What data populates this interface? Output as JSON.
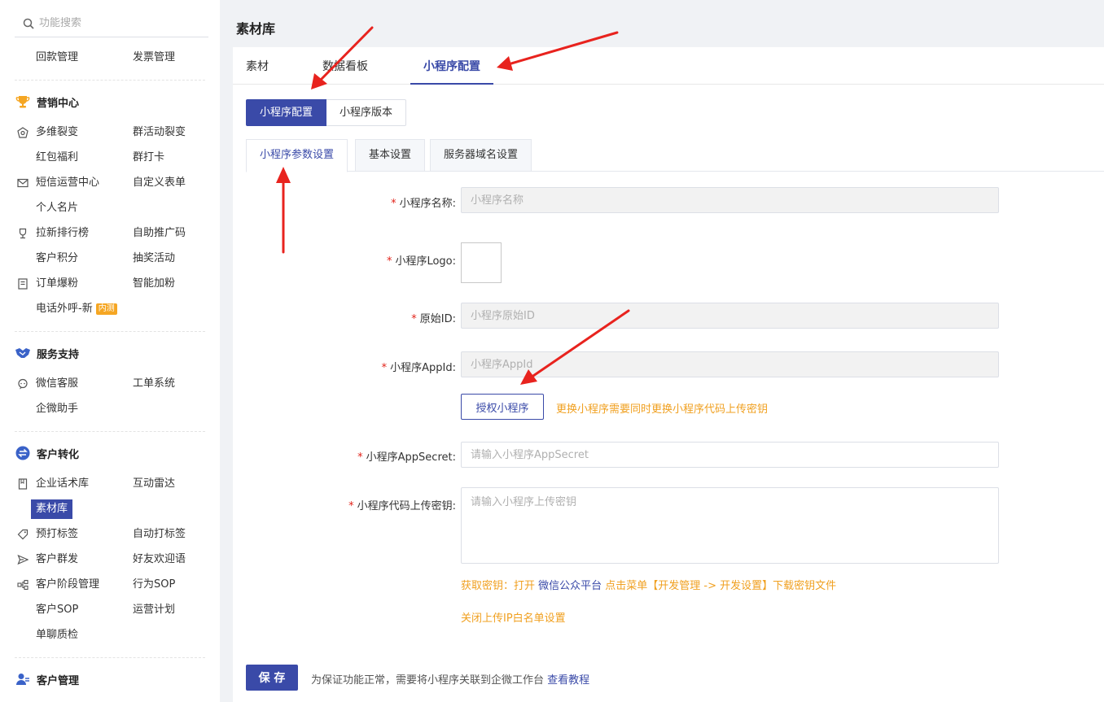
{
  "colors": {
    "accent": "#3a4aa8",
    "hint": "#f0a020",
    "required": "#e2231a",
    "arrow": "#e8231e"
  },
  "sidebar": {
    "search_placeholder": "功能搜索",
    "top": {
      "left": "回款管理",
      "right": "发票管理"
    },
    "marketing": {
      "title": "营销中心",
      "icon": "trophy-icon",
      "rows": [
        {
          "left": "多维裂变",
          "right": "群活动裂变",
          "icon": "network-icon"
        },
        {
          "left": "红包福利",
          "right": "群打卡"
        },
        {
          "left": "短信运营中心",
          "right": "自定义表单",
          "icon": "mail-icon"
        },
        {
          "left": "个人名片",
          "right": ""
        },
        {
          "left": "拉新排行榜",
          "right": "自助推广码",
          "icon": "cup-icon"
        },
        {
          "left": "客户积分",
          "right": "抽奖活动"
        },
        {
          "left": "订单爆粉",
          "right": "智能加粉",
          "icon": "order-icon"
        },
        {
          "left": "电话外呼-新",
          "right": "",
          "badge": "内测"
        }
      ]
    },
    "service": {
      "title": "服务支持",
      "icon": "handshake-icon",
      "rows": [
        {
          "left": "微信客服",
          "right": "工单系统",
          "icon": "chat-icon"
        },
        {
          "left": "企微助手",
          "right": ""
        }
      ]
    },
    "conversion": {
      "title": "客户转化",
      "icon": "swap-icon",
      "rows": [
        {
          "left": "企业话术库",
          "right": "互动雷达",
          "icon": "book-icon"
        },
        {
          "left": "素材库",
          "right": "",
          "active": true
        },
        {
          "left": "预打标签",
          "right": "自动打标签",
          "icon": "tag-icon"
        },
        {
          "left": "客户群发",
          "right": "好友欢迎语",
          "icon": "send-icon"
        },
        {
          "left": "客户阶段管理",
          "right": "行为SOP",
          "icon": "flow-icon"
        },
        {
          "left": "客户SOP",
          "right": "运营计划"
        },
        {
          "left": "单聊质检",
          "right": ""
        }
      ]
    },
    "customer": {
      "title": "客户管理",
      "icon": "user-manage-icon"
    }
  },
  "main": {
    "page_title": "素材库",
    "top_tabs": [
      "素材",
      "数据看板",
      "小程序配置"
    ],
    "active_top_tab": 2,
    "button_group": [
      "小程序配置",
      "小程序版本"
    ],
    "sub_tabs": [
      "小程序参数设置",
      "基本设置",
      "服务器域名设置"
    ],
    "form": {
      "name_label": "小程序名称:",
      "name_placeholder": "小程序名称",
      "logo_label": "小程序Logo:",
      "original_id_label": "原始ID:",
      "original_id_placeholder": "小程序原始ID",
      "appid_label": "小程序AppId:",
      "appid_placeholder": "小程序AppId",
      "auth_button": "授权小程序",
      "auth_hint": "更换小程序需要同时更换小程序代码上传密钥",
      "secret_label": "小程序AppSecret:",
      "secret_placeholder": "请输入小程序AppSecret",
      "upload_key_label": "小程序代码上传密钥:",
      "upload_key_placeholder": "请输入小程序上传密钥",
      "key_hint_prefix": "获取密钥：打开 ",
      "key_hint_link": "微信公众平台",
      "key_hint_suffix": " 点击菜单【开发管理 -> 开发设置】下载密钥文件",
      "ip_hint": "关闭上传IP白名单设置"
    },
    "save_button": "保 存",
    "footnote_text": "为保证功能正常，需要将小程序关联到企微工作台 ",
    "footnote_link": "查看教程"
  }
}
